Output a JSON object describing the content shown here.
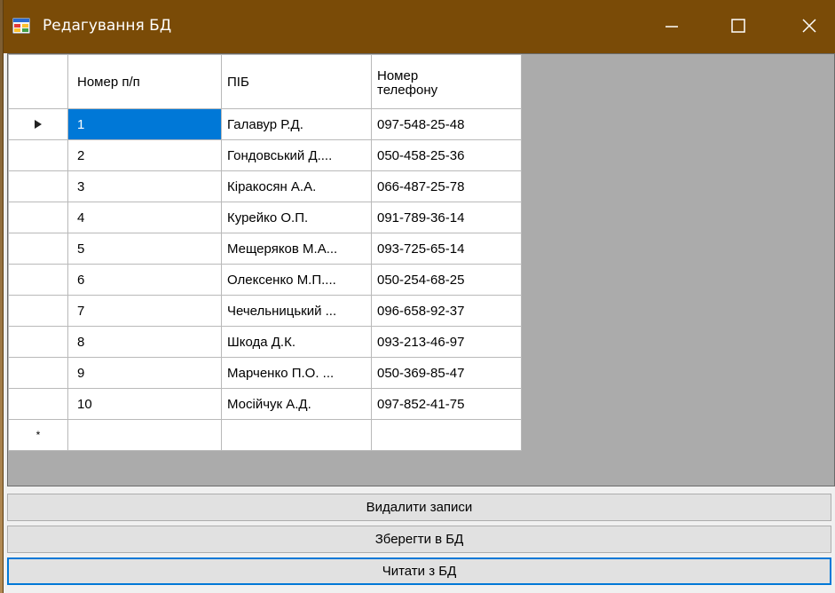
{
  "window": {
    "title": "Редагування БД"
  },
  "grid": {
    "headers": {
      "num": "Номер п/п",
      "name": "ПІБ",
      "phone_line1": "Номер",
      "phone_line2": "телефону"
    },
    "rows": [
      {
        "num": "1",
        "name": "Галавур Р.Д.",
        "phone": "097-548-25-48"
      },
      {
        "num": "2",
        "name": "Гондовський Д....",
        "phone": "050-458-25-36"
      },
      {
        "num": "3",
        "name": "Кіракосян А.А.",
        "phone": "066-487-25-78"
      },
      {
        "num": "4",
        "name": "Курейко О.П.",
        "phone": "091-789-36-14"
      },
      {
        "num": "5",
        "name": "Мещеряков М.А...",
        "phone": "093-725-65-14"
      },
      {
        "num": "6",
        "name": "Олексенко М.П....",
        "phone": "050-254-68-25"
      },
      {
        "num": "7",
        "name": "Чечельницький ...",
        "phone": "096-658-92-37"
      },
      {
        "num": "8",
        "name": "Шкода Д.К.",
        "phone": "093-213-46-97"
      },
      {
        "num": "9",
        "name": "Марченко П.О. ...",
        "phone": "050-369-85-47"
      },
      {
        "num": "10",
        "name": "Мосійчук А.Д.",
        "phone": "097-852-41-75"
      }
    ],
    "new_row_marker": "*",
    "current_row_marker": "▶"
  },
  "buttons": {
    "delete": "Видалити записи",
    "save": "Зберегти в БД",
    "read": "Читати з БД"
  },
  "colors": {
    "titlebar": "#7a4b07",
    "selection": "#0078d7"
  }
}
